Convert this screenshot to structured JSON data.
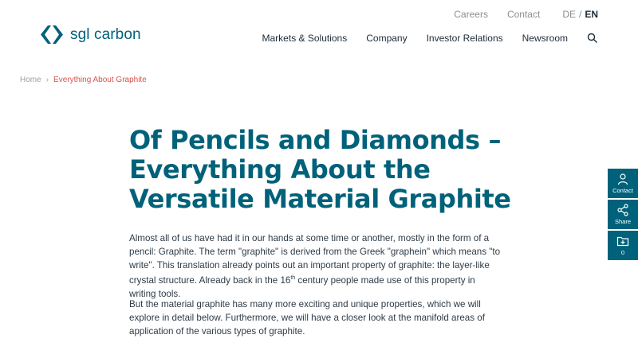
{
  "topbar": {
    "careers": "Careers",
    "contact": "Contact",
    "lang_de": "DE",
    "lang_sep": "/",
    "lang_en": "EN"
  },
  "logo": {
    "brand": "sgl carbon",
    "icon": "sgl-carbon-logo-icon"
  },
  "nav": {
    "items": [
      "Markets & Solutions",
      "Company",
      "Investor Relations",
      "Newsroom"
    ],
    "search_icon": "search-icon"
  },
  "breadcrumb": {
    "home": "Home",
    "current": "Everything About Graphite"
  },
  "article": {
    "title": "Of Pencils and Diamonds – Everything About the Versatile Material Graphite",
    "p1_part1": "Almost all of us have had it in our hands at some time or another, mostly in the form of a pencil: Graphite. The term \"graphite\" is derived from the Greek \"graphein\" which means \"to write\". This translation already points out an important property of graphite: the layer-like crystal structure. Already back in the 16",
    "p1_sup": "th",
    "p1_part2": " century people made use of this property in writing tools.",
    "p2": "But the material graphite has many more exciting and unique properties, which we will explore in detail below. Furthermore, we will have a closer look at the manifold areas of application of the various types of graphite."
  },
  "sidebar": {
    "contact": "Contact",
    "share": "Share",
    "folder_count": "0"
  },
  "colors": {
    "primary": "#00617a",
    "accent": "#d9534f",
    "text": "#2d3b47"
  }
}
